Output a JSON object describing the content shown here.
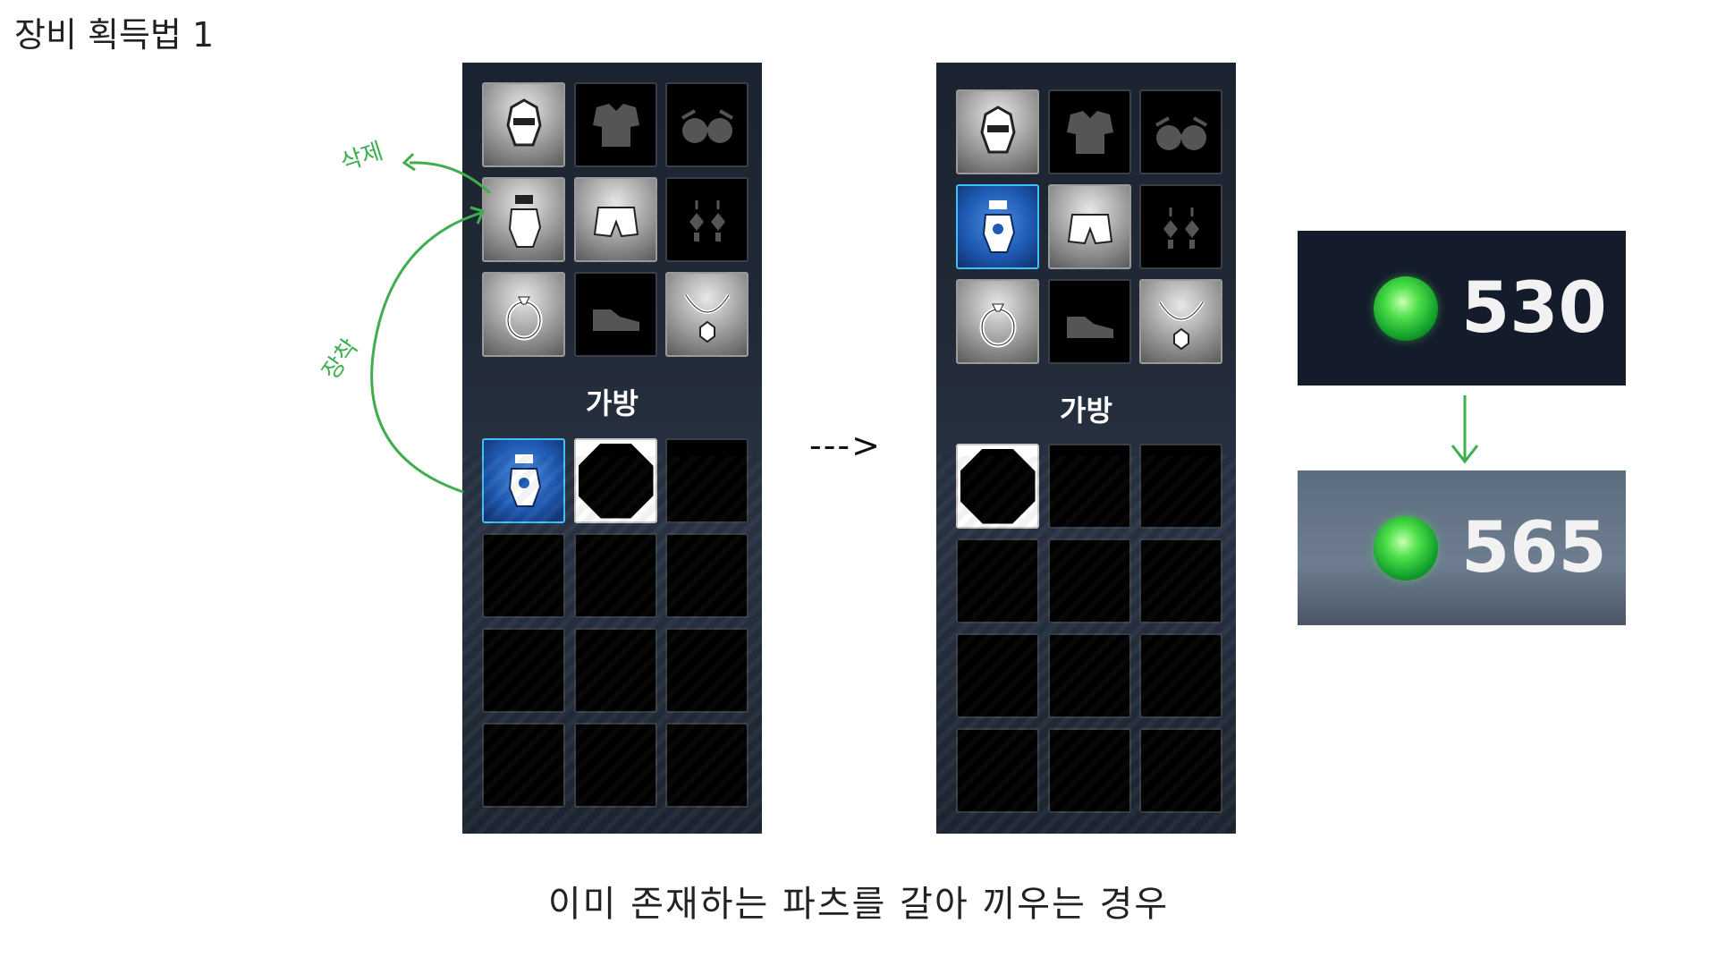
{
  "title": "장비 획득법 1",
  "caption": "이미 존재하는 파츠를 갈아 끼우는 경우",
  "flow_arrow": "--->",
  "panel_before": {
    "bag_label": "가방",
    "equip_slots": [
      {
        "icon": "helmet-icon",
        "state": "equipped"
      },
      {
        "icon": "armor-icon",
        "state": "empty"
      },
      {
        "icon": "glasses-icon",
        "state": "empty"
      },
      {
        "icon": "glove-icon",
        "state": "equipped"
      },
      {
        "icon": "shorts-icon",
        "state": "equipped"
      },
      {
        "icon": "earrings-icon",
        "state": "empty"
      },
      {
        "icon": "ring-icon",
        "state": "equipped"
      },
      {
        "icon": "shoe-icon",
        "state": "empty"
      },
      {
        "icon": "necklace-icon",
        "state": "equipped"
      }
    ],
    "bag_slots": [
      "rare-glove-item",
      "octagon-item",
      "empty",
      "empty",
      "empty",
      "empty",
      "empty",
      "empty",
      "empty",
      "empty",
      "empty",
      "empty"
    ]
  },
  "panel_after": {
    "bag_label": "가방",
    "equip_slots": [
      {
        "icon": "helmet-icon",
        "state": "equipped"
      },
      {
        "icon": "armor-icon",
        "state": "empty"
      },
      {
        "icon": "glasses-icon",
        "state": "empty"
      },
      {
        "icon": "glove-icon",
        "state": "rare"
      },
      {
        "icon": "shorts-icon",
        "state": "equipped"
      },
      {
        "icon": "earrings-icon",
        "state": "empty"
      },
      {
        "icon": "ring-icon",
        "state": "equipped"
      },
      {
        "icon": "shoe-icon",
        "state": "empty"
      },
      {
        "icon": "necklace-icon",
        "state": "equipped"
      }
    ],
    "bag_slots": [
      "octagon-item",
      "empty",
      "empty",
      "empty",
      "empty",
      "empty",
      "empty",
      "empty",
      "empty",
      "empty",
      "empty",
      "empty"
    ]
  },
  "annotations": {
    "remove_label": "삭제",
    "equip_label": "장착",
    "color": "#3fae4f"
  },
  "currency": {
    "icon": "green-gem-icon",
    "before_value": "530",
    "after_value": "565"
  }
}
